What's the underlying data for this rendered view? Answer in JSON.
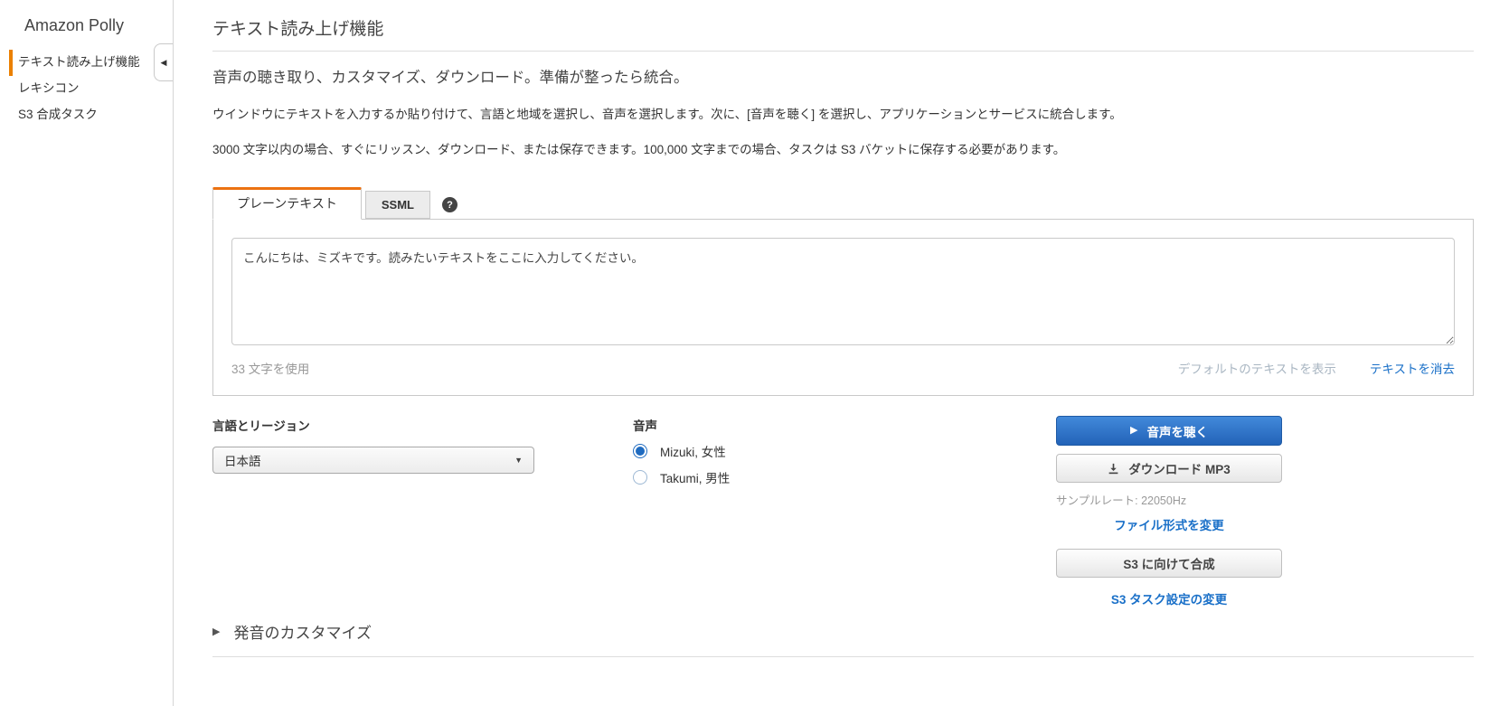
{
  "sidebar": {
    "title": "Amazon Polly",
    "items": [
      {
        "label": "テキスト読み上げ機能",
        "active": true
      },
      {
        "label": "レキシコン",
        "active": false
      },
      {
        "label": "S3 合成タスク",
        "active": false
      }
    ]
  },
  "icons": {
    "collapse": "◀",
    "play": "▶",
    "caret": "▼",
    "expander_arrow": "▶",
    "help": "?"
  },
  "header": {
    "title": "テキスト読み上げ機能",
    "subtitle": "音声の聴き取り、カスタマイズ、ダウンロード。準備が整ったら統合。",
    "description_1": "ウインドウにテキストを入力するか貼り付けて、言語と地域を選択し、音声を選択します。次に、[音声を聴く] を選択し、アプリケーションとサービスに統合します。",
    "description_2": "3000 文字以内の場合、すぐにリッスン、ダウンロード、または保存できます。100,000 文字までの場合、タスクは S3 バケットに保存する必要があります。"
  },
  "editor": {
    "tabs": [
      {
        "label": "プレーンテキスト",
        "active": true
      },
      {
        "label": "SSML",
        "active": false
      }
    ],
    "text_value": "こんにちは、ミズキです。読みたいテキストをここに入力してください。",
    "char_count": "33 文字を使用",
    "show_default_label": "デフォルトのテキストを表示",
    "clear_text_label": "テキストを消去"
  },
  "language": {
    "label": "言語とリージョン",
    "selected": "日本語"
  },
  "voice": {
    "label": "音声",
    "options": [
      {
        "label": "Mizuki, 女性",
        "selected": true
      },
      {
        "label": "Takumi, 男性",
        "selected": false
      }
    ]
  },
  "actions": {
    "listen_label": "音声を聴く",
    "download_label": "ダウンロード MP3",
    "sample_rate": "サンプルレート: 22050Hz",
    "change_format_label": "ファイル形式を変更",
    "synthesize_label": "S3 に向けて合成",
    "s3_settings_label": "S3 タスク設定の変更"
  },
  "expander": {
    "label": "発音のカスタマイズ"
  },
  "colors": {
    "accent_orange": "#eb8000",
    "tab_orange": "#ec7211",
    "link_blue": "#1a70c8",
    "button_blue_top": "#4289da",
    "button_blue_bottom": "#2263b8"
  }
}
